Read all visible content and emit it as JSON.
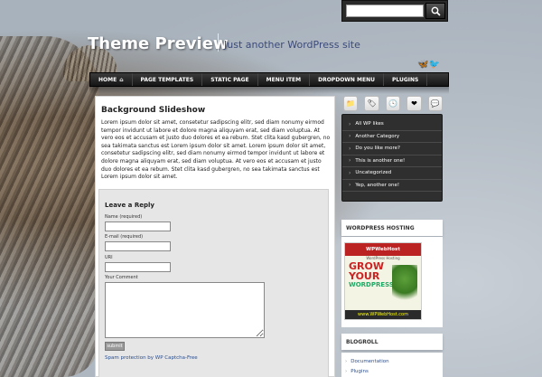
{
  "search": {
    "placeholder": ""
  },
  "site": {
    "title": "Theme Preview",
    "description": "Just another WordPress site"
  },
  "nav": {
    "items": [
      {
        "label": "HOME"
      },
      {
        "label": "PAGE TEMPLATES"
      },
      {
        "label": "STATIC PAGE"
      },
      {
        "label": "MENU ITEM"
      },
      {
        "label": "DROPDOWN MENU"
      },
      {
        "label": "PLUGINS"
      }
    ]
  },
  "post": {
    "title": "Background Slideshow",
    "body": "Lorem ipsum dolor sit amet, consetetur sadipscing elitr, sed diam nonumy eirmod tempor invidunt ut labore et dolore magna aliquyam erat, sed diam voluptua. At vero eos et accusam et justo duo dolores et ea rebum. Stet clita kasd gubergren, no sea takimata sanctus est Lorem ipsum dolor sit amet. Lorem ipsum dolor sit amet, consetetur sadipscing elitr, sed diam nonumy eirmod tempor invidunt ut labore et dolore magna aliquyam erat, sed diam voluptua. At vero eos et accusam et justo duo dolores et ea rebum. Stet clita kasd gubergren, no sea takimata sanctus est Lorem ipsum dolor sit amet."
  },
  "reply": {
    "heading": "Leave a Reply",
    "name_label": "Name (required)",
    "email_label": "E-mail (required)",
    "uri_label": "URI",
    "comment_label": "Your Comment",
    "submit_label": "submit",
    "spam_text": "Spam protection by WP Captcha-Free"
  },
  "sidebar": {
    "categories": [
      {
        "label": "All WP likes"
      },
      {
        "label": "Another Category"
      },
      {
        "label": "Do you like more?"
      },
      {
        "label": "This is another one!"
      },
      {
        "label": "Uncategorized"
      },
      {
        "label": "Yep, another one!"
      }
    ],
    "hosting_title": "WORDPRESS HOSTING",
    "ad": {
      "brand": "WPWebHost",
      "tagline": "WordPress Hosting",
      "grow": "GROW",
      "your": "YOUR",
      "wordpress": "WORDPRESS",
      "url": "www.WPWebHost.com"
    },
    "blogroll_title": "BLOGROLL",
    "blogroll": [
      {
        "label": "Documentation"
      },
      {
        "label": "Plugins"
      }
    ]
  },
  "colors": {
    "nav_bg": "#1f1f1f",
    "link": "#2b4d8c",
    "cat_bg": "#2f2f2f"
  }
}
